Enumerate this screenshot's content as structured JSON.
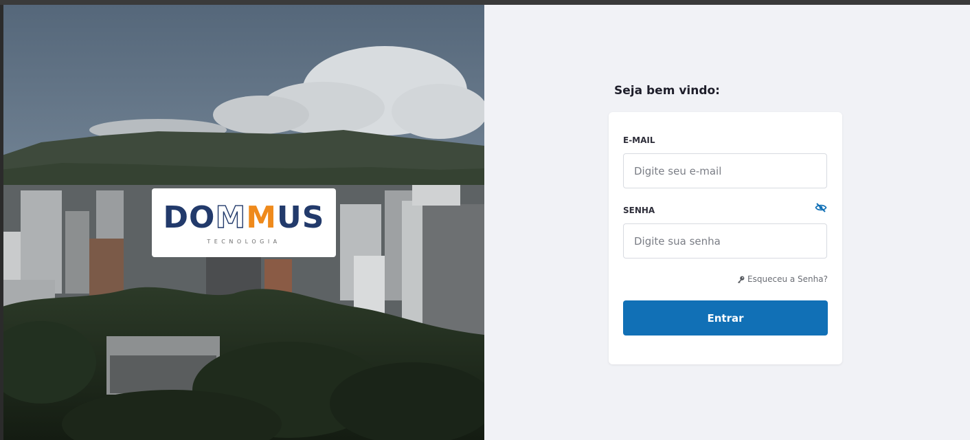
{
  "brand": {
    "logo_text_parts": [
      "DO",
      "M",
      "M",
      "US"
    ],
    "logo_tagline": "TECNOLOGIA"
  },
  "login": {
    "welcome_title": "Seja bem vindo:",
    "email_label": "E-MAIL",
    "email_placeholder": "Digite seu e-mail",
    "email_value": "",
    "password_label": "SENHA",
    "password_placeholder": "Digite sua senha",
    "password_value": "",
    "toggle_visibility_icon": "eye-slash-icon",
    "forgot_password_icon": "key-icon",
    "forgot_password_label": "Esqueceu a Senha?",
    "submit_label": "Entrar"
  },
  "colors": {
    "brand_navy": "#223a6b",
    "brand_orange": "#ef8a1c",
    "primary_button": "#1170b6",
    "page_background": "#f1f2f6"
  }
}
